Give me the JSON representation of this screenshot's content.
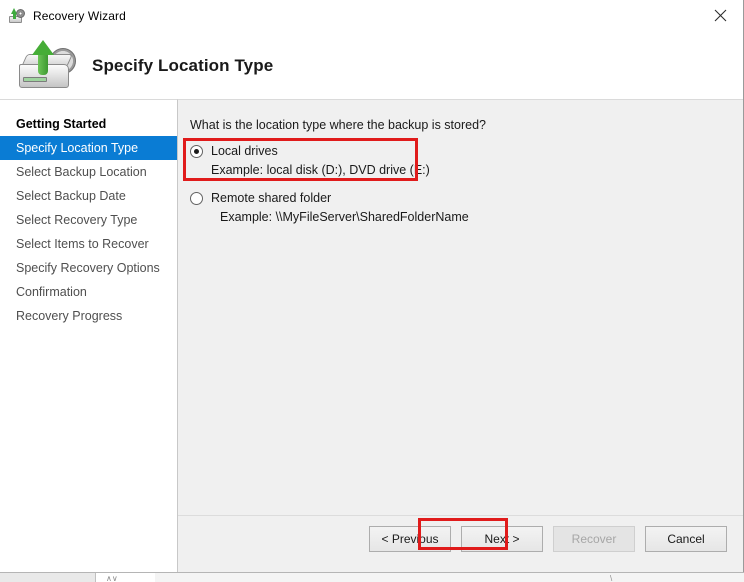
{
  "window": {
    "title": "Recovery Wizard",
    "title_icon": "recovery-disk-icon",
    "close_icon": "close-icon"
  },
  "header": {
    "icon": "recovery-drive-icon",
    "title": "Specify Location Type"
  },
  "sidebar": {
    "items": [
      {
        "label": "Getting Started",
        "state": "first"
      },
      {
        "label": "Specify Location Type",
        "state": "selected"
      },
      {
        "label": "Select Backup Location",
        "state": "normal"
      },
      {
        "label": "Select Backup Date",
        "state": "normal"
      },
      {
        "label": "Select Recovery Type",
        "state": "normal"
      },
      {
        "label": "Select Items to Recover",
        "state": "normal"
      },
      {
        "label": "Specify Recovery Options",
        "state": "normal"
      },
      {
        "label": "Confirmation",
        "state": "normal"
      },
      {
        "label": "Recovery Progress",
        "state": "normal"
      }
    ]
  },
  "main": {
    "question": "What is the location type where the backup is stored?",
    "options": [
      {
        "label": "Local drives",
        "example": "Example: local disk (D:), DVD drive (E:)",
        "selected": true,
        "highlighted": true
      },
      {
        "label": "Remote shared folder",
        "example": "Example: \\\\MyFileServer\\SharedFolderName",
        "selected": false,
        "highlighted": false
      }
    ]
  },
  "footer": {
    "buttons": [
      {
        "label": "< Previous",
        "disabled": false,
        "highlighted": false
      },
      {
        "label": "Next >",
        "disabled": false,
        "highlighted": true
      },
      {
        "label": "Recover",
        "disabled": true,
        "highlighted": false
      },
      {
        "label": "Cancel",
        "disabled": false,
        "highlighted": false
      }
    ]
  },
  "colors": {
    "accent_selected": "#0a7cd4",
    "highlight_red": "#e01b1b",
    "content_bg": "#f0f0f0",
    "sidebar_bg": "#ffffff"
  }
}
